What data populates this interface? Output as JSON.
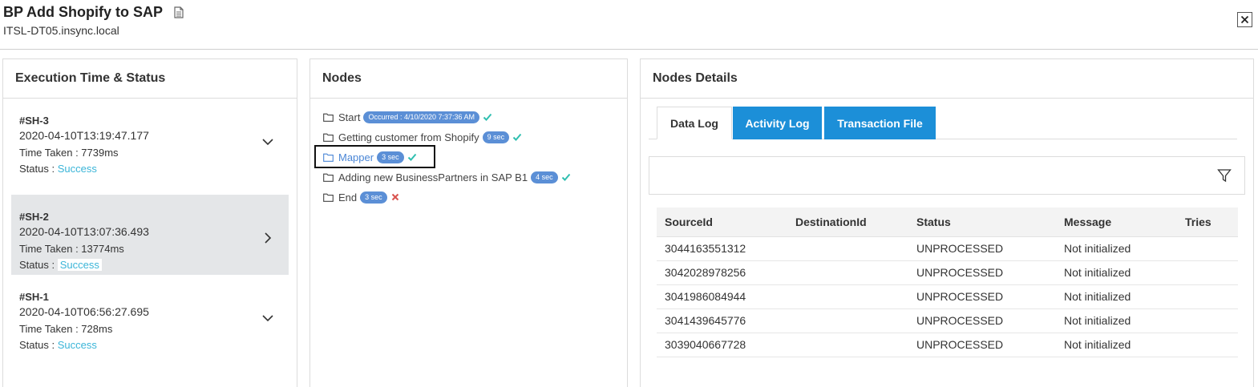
{
  "header": {
    "title": "BP Add Shopify to SAP",
    "host": "ITSL-DT05.insync.local",
    "close_label": "×"
  },
  "executions": {
    "title": "Execution Time & Status",
    "status_label": "Status :",
    "items": [
      {
        "id": "#SH-3",
        "date": "2020-04-10T13:19:47.177",
        "time_taken": "Time Taken : 7739ms",
        "status": "Success"
      },
      {
        "id": "#SH-2",
        "date": "2020-04-10T13:07:36.493",
        "time_taken": "Time Taken : 13774ms",
        "status": "Success"
      },
      {
        "id": "#SH-1",
        "date": "2020-04-10T06:56:27.695",
        "time_taken": "Time Taken : 728ms",
        "status": "Success"
      }
    ]
  },
  "nodes": {
    "title": "Nodes",
    "items": [
      {
        "label": "Start",
        "badge": "Occurred : 4/10/2020 7:37:36 AM",
        "result": "success"
      },
      {
        "label": "Getting customer from Shopify",
        "badge": "9 sec",
        "result": "success"
      },
      {
        "label": "Mapper",
        "badge": "3 sec",
        "result": "success"
      },
      {
        "label": "Adding new BusinessPartners in SAP B1",
        "badge": "4 sec",
        "result": "success"
      },
      {
        "label": "End",
        "badge": "3 sec",
        "result": "error"
      }
    ]
  },
  "details": {
    "title": "Nodes Details",
    "tabs": [
      "Data Log",
      "Activity Log",
      "Transaction File"
    ],
    "columns": [
      "SourceId",
      "DestinationId",
      "Status",
      "Message",
      "Tries"
    ],
    "rows": [
      [
        "3044163551312",
        "",
        "UNPROCESSED",
        "Not initialized",
        ""
      ],
      [
        "3042028978256",
        "",
        "UNPROCESSED",
        "Not initialized",
        ""
      ],
      [
        "3041986084944",
        "",
        "UNPROCESSED",
        "Not initialized",
        ""
      ],
      [
        "3041439645776",
        "",
        "UNPROCESSED",
        "Not initialized",
        ""
      ],
      [
        "3039040667728",
        "",
        "UNPROCESSED",
        "Not initialized",
        ""
      ]
    ]
  },
  "colors": {
    "accent_blue": "#1c8fd8",
    "badge_blue": "#5b8fd6",
    "success_teal": "#3bb5d8",
    "check_teal": "#2fbfb0",
    "error_red": "#d9534f",
    "selected_bg": "#e4e6e8"
  },
  "icons": {
    "document": "document-icon",
    "close": "close-icon",
    "chevron_down": "chevron-down-icon",
    "chevron_right": "chevron-right-icon",
    "folder": "folder-icon",
    "check": "check-icon",
    "cross": "cross-icon",
    "filter": "filter-icon"
  }
}
